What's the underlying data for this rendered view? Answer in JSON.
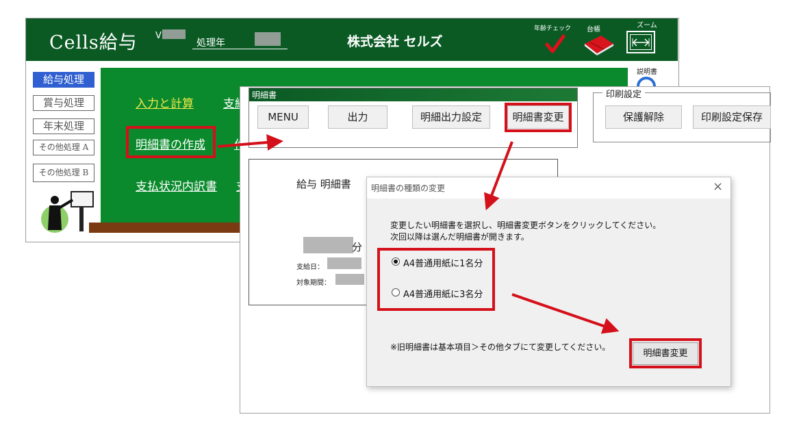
{
  "menu_window": {
    "app_title": "Cells給与",
    "version_prefix": "V",
    "period_label": "処理年",
    "company_name": "株式会社 セルズ",
    "age_check_label": "年齢チェック",
    "ledger_label": "台帳",
    "zoom_label": "ズーム",
    "manual_label": "説明書",
    "side_buttons": [
      {
        "label": "給与処理"
      },
      {
        "label": "賞与処理"
      },
      {
        "label": "年末処理"
      },
      {
        "label": "その他処理 A"
      },
      {
        "label": "その他処理 B"
      }
    ],
    "links": {
      "input_calc": "入力と計算",
      "input_calc_2": "支給",
      "payslip": "明細書の作成",
      "payslip_2": "作",
      "payment_detail": "支払状況内訳書",
      "payment_detail_2": "支"
    },
    "icons": {
      "age_check": "checkmark-icon",
      "ledger": "book-icon",
      "zoom": "zoom-arrows-icon",
      "manual": "info-icon",
      "mascot": "presenter-icon"
    }
  },
  "sheet_window": {
    "title": "明細書",
    "toolbar": {
      "menu": "MENU",
      "output": "出力",
      "output_settings": "明細出力設定",
      "change_slip": "明細書変更"
    },
    "print_settings": {
      "title": "印刷設定",
      "unprotect": "保護解除",
      "save_print": "印刷設定保存"
    },
    "slip": {
      "title": "給与 明細書",
      "name_suffix": "分",
      "pay_date_label": "支給日：",
      "period_label": "対象期間："
    }
  },
  "dialog": {
    "title": "明細書の種類の変更",
    "close": "×",
    "message_1": "変更したい明細書を選択し、明細書変更ボタンをクリックしてください。",
    "message_2": "次回以降は選んだ明細書が開きます。",
    "options": [
      {
        "label": "A4普通用紙に1名分",
        "selected": true
      },
      {
        "label": "A4普通用紙に3名分",
        "selected": false
      }
    ],
    "note": "※旧明細書は基本項目＞その他タブにて変更してください。",
    "change_button": "明細書変更"
  },
  "colors": {
    "header_green": "#0b5a24",
    "panel_green": "#0a8a2c",
    "highlight_red": "#d4101a",
    "active_side_button": "#2f5fd0",
    "link_yellow": "#f2e84a"
  }
}
